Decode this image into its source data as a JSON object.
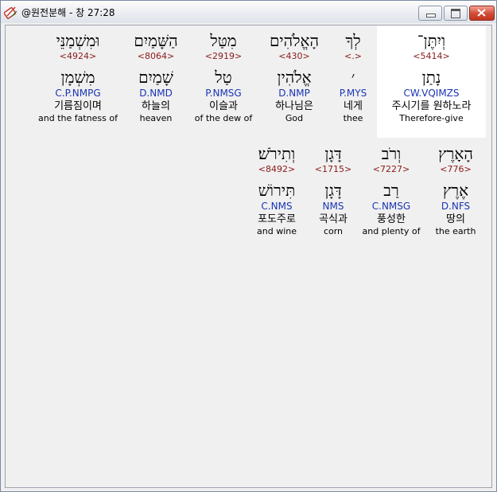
{
  "window": {
    "title": "@원전분해 - 창 27:28"
  },
  "words": [
    {
      "hebrew": "וְיִתֶּן־",
      "strong": "<5414>",
      "lemma": "נָתַן",
      "parse": "CW.VQIMZS",
      "korean": "주시기를 원하노라",
      "english": "Therefore-give",
      "selected": true
    },
    {
      "hebrew": "לְךָ",
      "strong": "<.>",
      "lemma": "׳",
      "parse": "P.MYS",
      "korean": "네게",
      "english": "thee"
    },
    {
      "hebrew": "הָאֱלֹהִים",
      "strong": "<430>",
      "lemma": "אֱלֹהִין",
      "parse": "D.NMP",
      "korean": "하나님은",
      "english": "God"
    },
    {
      "hebrew": "מִטַּל",
      "strong": "<2919>",
      "lemma": "טַל",
      "parse": "P.NMSG",
      "korean": "이슬과",
      "english": "of the dew of"
    },
    {
      "hebrew": "הַשָּׁמַיִם",
      "strong": "<8064>",
      "lemma": "שָׁמַיִם",
      "parse": "D.NMD",
      "korean": "하늘의",
      "english": "heaven"
    },
    {
      "hebrew": "וּמִשְׁמַנֵּי",
      "strong": "<4924>",
      "lemma": "מִשְׁמָן",
      "parse": "C.P.NMPG",
      "korean": "기름짐이며",
      "english": "and the fatness of"
    },
    {
      "hebrew": "הָאָרֶץ",
      "strong": "<776>",
      "lemma": "אֶרֶץ",
      "parse": "D.NFS",
      "korean": "땅의",
      "english": "the earth"
    },
    {
      "hebrew": "וְרֹב",
      "strong": "<7227>",
      "lemma": "רַב",
      "parse": "C.NMSG",
      "korean": "풍성한",
      "english": "and plenty of"
    },
    {
      "hebrew": "דָּגָן",
      "strong": "<1715>",
      "lemma": "דָּגָן",
      "parse": "NMS",
      "korean": "곡식과",
      "english": "corn"
    },
    {
      "hebrew": "וְתִירֹשׁ׃",
      "strong": "<8492>",
      "lemma": "תִּירוֹשׁ",
      "parse": "C.NMS",
      "korean": "포도주로",
      "english": "and wine"
    }
  ]
}
